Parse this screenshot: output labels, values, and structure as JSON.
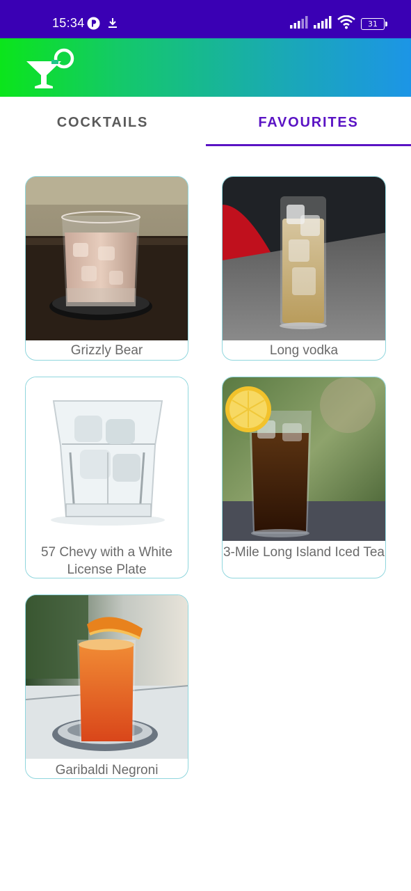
{
  "status_bar": {
    "time": "15:34",
    "battery_level": "31",
    "icons": [
      "app-notification-icon",
      "download-icon",
      "signal-icon",
      "signal-icon",
      "wifi-icon",
      "battery-icon"
    ]
  },
  "app_bar": {
    "logo_icon": "cocktail-glass-icon",
    "colors": {
      "gradient_start": "#0be51b",
      "gradient_end": "#1c95e6"
    }
  },
  "tabs": [
    {
      "label": "COCKTAILS",
      "selected": false
    },
    {
      "label": "FAVOURITES",
      "selected": true
    }
  ],
  "accent_color": "#5a13c4",
  "favourites": [
    {
      "name": "Grizzly Bear"
    },
    {
      "name": "Long vodka"
    },
    {
      "name": "57 Chevy with a White License Plate"
    },
    {
      "name": "3-Mile Long Island Iced Tea"
    },
    {
      "name": "Garibaldi Negroni"
    }
  ]
}
